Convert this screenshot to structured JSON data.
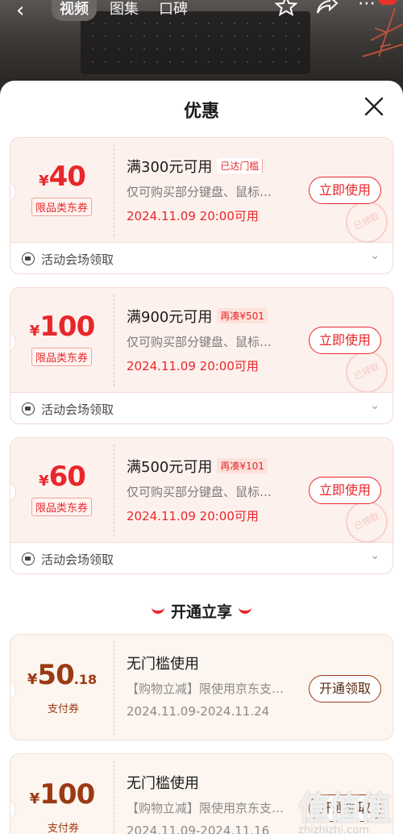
{
  "topbar": {
    "back": "‹",
    "tabs": [
      "视频",
      "图集",
      "口碑"
    ],
    "icons": [
      "star-icon",
      "share-icon",
      "more-icon"
    ]
  },
  "sheet": {
    "title": "优惠"
  },
  "coupons": [
    {
      "yen": "¥",
      "amount": "40",
      "tag": "限品类东券",
      "condition": "满300元可用",
      "cond_tag": "已达门槛",
      "desc": "仅可购买部分键盘、鼠标…",
      "expire": "2024.11.09 20:00可用",
      "button": "立即使用",
      "stamp": "已领取",
      "footer": "活动会场领取"
    },
    {
      "yen": "¥",
      "amount": "100",
      "tag": "限品类东券",
      "condition": "满900元可用",
      "cond_tag": "再凑¥501",
      "desc": "仅可购买部分键盘、鼠标…",
      "expire": "2024.11.09 20:00可用",
      "button": "立即使用",
      "stamp": "已领取",
      "footer": "活动会场领取"
    },
    {
      "yen": "¥",
      "amount": "60",
      "tag": "限品类东券",
      "condition": "满500元可用",
      "cond_tag": "再凑¥101",
      "desc": "仅可购买部分键盘、鼠标…",
      "expire": "2024.11.09 20:00可用",
      "button": "立即使用",
      "stamp": "已领取",
      "footer": "活动会场领取"
    }
  ],
  "section": {
    "title": "开通立享"
  },
  "pay_coupons": [
    {
      "yen": "¥",
      "amount": "50",
      "decimal": ".18",
      "tag": "支付券",
      "condition": "无门槛使用",
      "desc": "【购物立减】限使用京东支…",
      "expire": "2024.11.09-2024.11.24",
      "button": "开通领取"
    },
    {
      "yen": "¥",
      "amount": "100",
      "decimal": "",
      "tag": "支付券",
      "condition": "无门槛使用",
      "desc": "【购物立减】限使用京东支…",
      "expire": "2024.11.09-2024.11.16",
      "button": "开通领取"
    }
  ],
  "watermark": {
    "big": "值值值",
    "small": "zhizhizhi.com"
  },
  "colors": {
    "accent": "#e8272b",
    "pay_accent": "#9b3a14"
  }
}
